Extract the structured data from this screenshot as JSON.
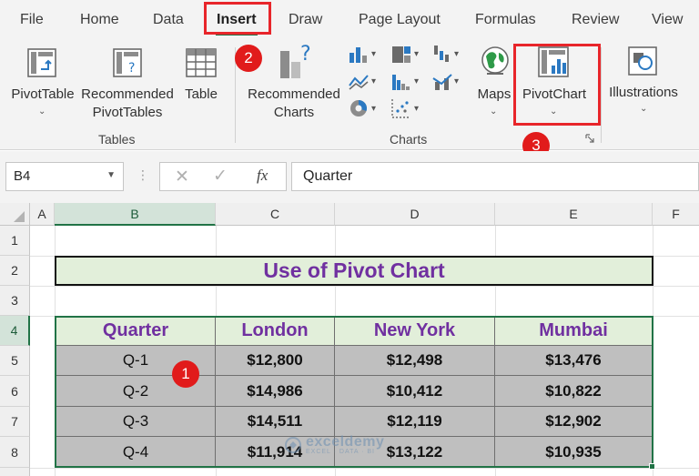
{
  "tabs": [
    "File",
    "Home",
    "Data",
    "Insert",
    "Draw",
    "Page Layout",
    "Formulas",
    "Review",
    "View"
  ],
  "active_tab": "Insert",
  "steps": [
    "1",
    "2",
    "3"
  ],
  "ribbon": {
    "pivottable": "PivotTable",
    "recommended_pivottables_1": "Recommended",
    "recommended_pivottables_2": "PivotTables",
    "table": "Table",
    "group_tables": "Tables",
    "recommended_charts_1": "Recommended",
    "recommended_charts_2": "Charts",
    "maps": "Maps",
    "pivotchart": "PivotChart",
    "illustrations": "Illustrations",
    "group_charts": "Charts"
  },
  "formula_bar": {
    "name_box": "B4",
    "fx": "fx",
    "formula": "Quarter"
  },
  "columns": [
    "A",
    "B",
    "C",
    "D",
    "E",
    "F"
  ],
  "rows": [
    "1",
    "2",
    "3",
    "4",
    "5",
    "6",
    "7",
    "8"
  ],
  "sheet": {
    "title": "Use of Pivot Chart",
    "headers": [
      "Quarter",
      "London",
      "New York",
      "Mumbai"
    ],
    "data": [
      [
        "Q-1",
        "$12,800",
        "$12,498",
        "$13,476"
      ],
      [
        "Q-2",
        "$14,986",
        "$10,412",
        "$10,822"
      ],
      [
        "Q-3",
        "$14,511",
        "$12,119",
        "$12,902"
      ],
      [
        "Q-4",
        "$11,914",
        "$13,122",
        "$10,935"
      ]
    ]
  },
  "watermark": {
    "name": "exceldemy",
    "tagline": "EXCEL · DATA · BI"
  },
  "colors": {
    "accent": "#217346",
    "title_text": "#7030a0",
    "header_fill": "#e2efda",
    "body_fill": "#bfbfbf",
    "highlight": "#e8252a"
  }
}
